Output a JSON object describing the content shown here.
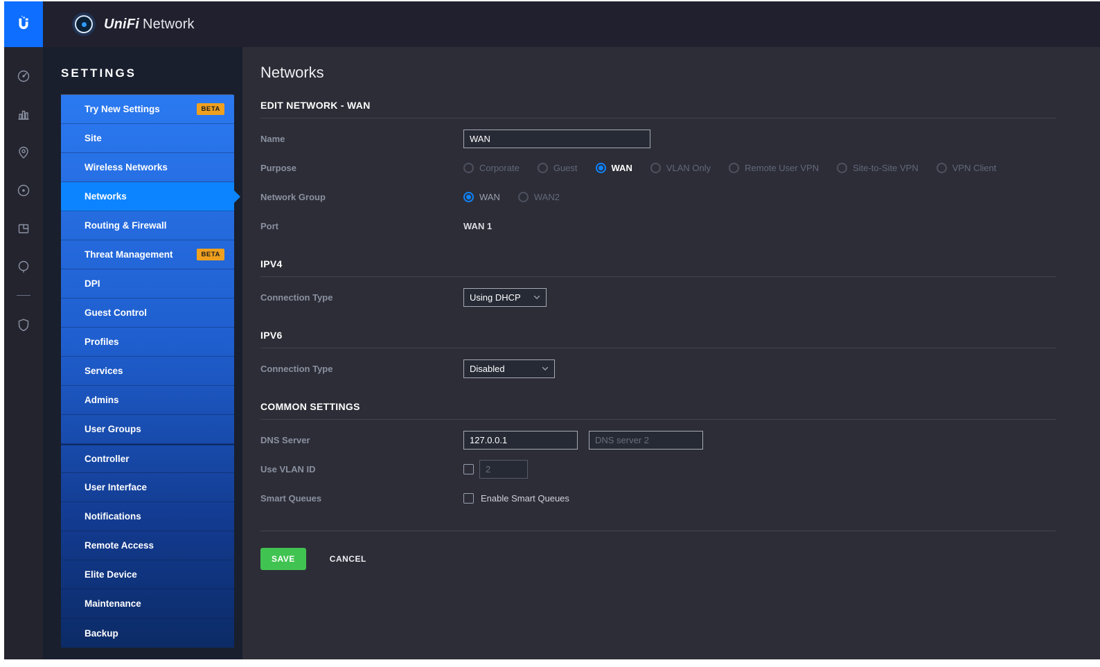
{
  "topbar": {
    "brand_primary": "UniFi",
    "brand_secondary": "Network"
  },
  "icon_rail": {
    "items": [
      "dashboard",
      "statistics",
      "map",
      "devices",
      "floorplan",
      "hotspot",
      "security"
    ]
  },
  "sidebar": {
    "heading": "SETTINGS",
    "beta_label": "BETA",
    "items": [
      {
        "label": "Try New Settings",
        "beta": true
      },
      {
        "label": "Site"
      },
      {
        "label": "Wireless Networks"
      },
      {
        "label": "Networks",
        "selected": true
      },
      {
        "label": "Routing & Firewall"
      },
      {
        "label": "Threat Management",
        "beta": true
      },
      {
        "label": "DPI"
      },
      {
        "label": "Guest Control"
      },
      {
        "label": "Profiles"
      },
      {
        "label": "Services"
      },
      {
        "label": "Admins"
      },
      {
        "label": "User Groups"
      },
      {
        "label": "Controller"
      },
      {
        "label": "User Interface"
      },
      {
        "label": "Notifications"
      },
      {
        "label": "Remote Access"
      },
      {
        "label": "Elite Device"
      },
      {
        "label": "Maintenance"
      },
      {
        "label": "Backup"
      }
    ]
  },
  "main": {
    "page_title": "Networks",
    "edit_section": {
      "title": "EDIT NETWORK - WAN"
    },
    "fields": {
      "name": {
        "label": "Name",
        "value": "WAN"
      },
      "purpose": {
        "label": "Purpose",
        "options": [
          {
            "label": "Corporate",
            "state": "disabled"
          },
          {
            "label": "Guest",
            "state": "disabled"
          },
          {
            "label": "WAN",
            "state": "selected"
          },
          {
            "label": "VLAN Only",
            "state": "disabled"
          },
          {
            "label": "Remote User VPN",
            "state": "disabled"
          },
          {
            "label": "Site-to-Site VPN",
            "state": "disabled"
          },
          {
            "label": "VPN Client",
            "state": "disabled"
          }
        ]
      },
      "network_group": {
        "label": "Network Group",
        "options": [
          {
            "label": "WAN",
            "state": "selected"
          },
          {
            "label": "WAN2",
            "state": "disabled"
          }
        ]
      },
      "port": {
        "label": "Port",
        "value": "WAN 1"
      }
    },
    "ipv4": {
      "title": "IPV4",
      "connection_type": {
        "label": "Connection Type",
        "value": "Using DHCP"
      }
    },
    "ipv6": {
      "title": "IPV6",
      "connection_type": {
        "label": "Connection Type",
        "value": "Disabled"
      }
    },
    "common": {
      "title": "COMMON SETTINGS",
      "dns": {
        "label": "DNS Server",
        "value": "127.0.0.1",
        "placeholder2": "DNS server 2"
      },
      "vlan": {
        "label": "Use VLAN ID",
        "placeholder": "2",
        "checked": false
      },
      "smart_queues": {
        "label": "Smart Queues",
        "checkbox_label": "Enable Smart Queues",
        "checked": false
      }
    },
    "actions": {
      "save": "SAVE",
      "cancel": "CANCEL"
    }
  },
  "colors": {
    "accent_blue": "#0d84ff",
    "menu_gradient_top": "#2b79f0",
    "menu_gradient_bottom": "#0c2b66",
    "save_green": "#41c351",
    "beta_badge": "#efa01e",
    "logo_blue": "#0d6eff"
  }
}
